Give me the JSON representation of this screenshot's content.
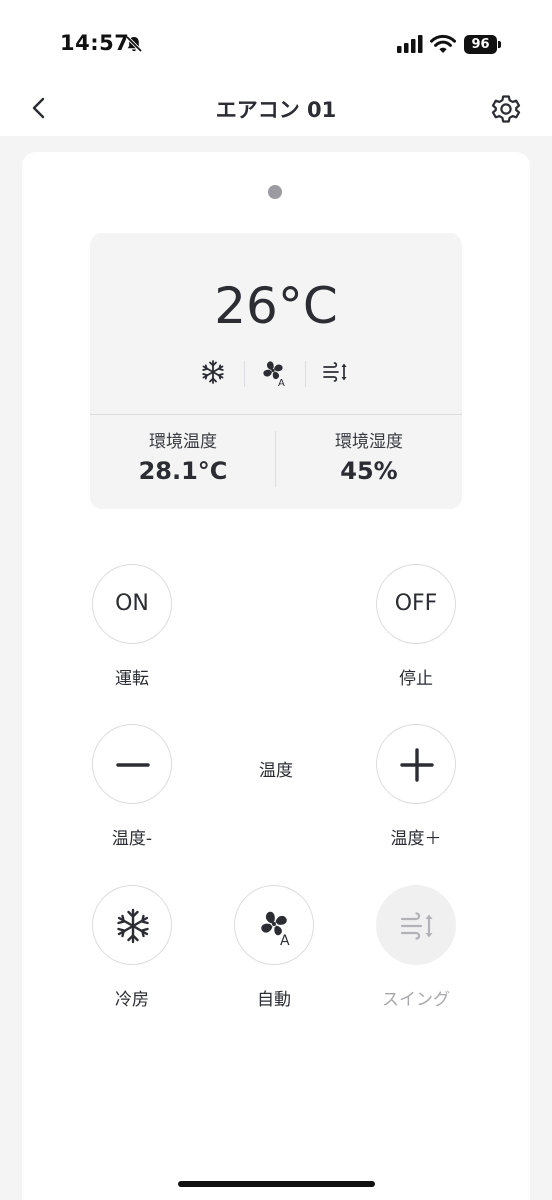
{
  "status_bar": {
    "time": "14:57",
    "battery": "96",
    "icons": [
      "bell-slash-icon",
      "signal-icon",
      "wifi-icon",
      "battery-icon"
    ]
  },
  "nav": {
    "title": "エアコン 01",
    "back_icon": "chevron-left-icon",
    "settings_icon": "gear-icon"
  },
  "display": {
    "set_temp": "26°C",
    "mode_icons": [
      "snowflake-icon",
      "fan-auto-icon",
      "swing-icon"
    ],
    "ambient_temp_label": "環境温度",
    "ambient_temp_value": "28.1°C",
    "ambient_humidity_label": "環境湿度",
    "ambient_humidity_value": "45%"
  },
  "controls": {
    "on_text": "ON",
    "on_label": "運転",
    "off_text": "OFF",
    "off_label": "停止",
    "temp_center_label": "温度",
    "temp_down_label": "温度-",
    "temp_up_label": "温度＋",
    "cool_label": "冷房",
    "fan_auto_label": "自動",
    "swing_label": "スイング",
    "swing_disabled": true
  },
  "colors": {
    "text": "#2b2d33",
    "panel": "#f4f4f5",
    "border": "#dcdcdf",
    "disabled": "#a9a9ad"
  }
}
